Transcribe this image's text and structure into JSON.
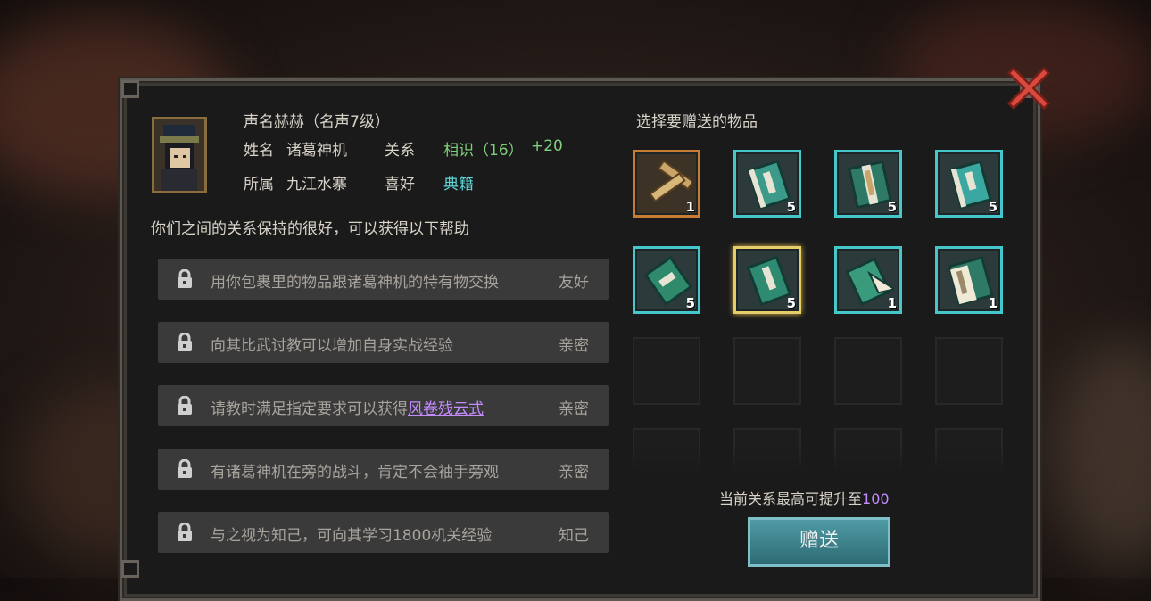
{
  "header": {
    "reputation": "声名赫赫（名声7级）",
    "name_label": "姓名",
    "name_value": "诸葛神机",
    "relation_label": "关系",
    "relation_value": "相识（16）",
    "relation_bonus": "+20",
    "faction_label": "所属",
    "faction_value": "九江水寨",
    "hobby_label": "喜好",
    "hobby_value": "典籍"
  },
  "benefits_intro": "你们之间的关系保持的很好，可以获得以下帮助",
  "benefits": [
    {
      "desc": "用你包裹里的物品跟诸葛神机的特有物交换",
      "level": "友好"
    },
    {
      "desc": "向其比武讨教可以增加自身实战经验",
      "level": "亲密"
    },
    {
      "desc_prefix": "请教时满足指定要求可以获得",
      "desc_link": "风卷残云式",
      "level": "亲密"
    },
    {
      "desc": "有诸葛神机在旁的战斗，肯定不会袖手旁观",
      "level": "亲密"
    },
    {
      "desc": "与之视为知己，可向其学习1800机关经验",
      "level": "知己"
    }
  ],
  "gift_title": "选择要赠送的物品",
  "items": [
    {
      "icon": "scroll-bundle-icon",
      "count": "1"
    },
    {
      "icon": "book-icon",
      "count": "5"
    },
    {
      "icon": "open-book-icon",
      "count": "5"
    },
    {
      "icon": "book-icon",
      "count": "5"
    },
    {
      "icon": "book-icon",
      "count": "5"
    },
    {
      "icon": "book-icon",
      "count": "5"
    },
    {
      "icon": "book-icon",
      "count": "1"
    },
    {
      "icon": "open-book-icon",
      "count": "1"
    }
  ],
  "max_text_prefix": "当前关系最高可提升至",
  "max_value": "100",
  "give_button": "赠送",
  "colors": {
    "accent_cyan": "#46c7cc",
    "relation_green": "#7fd07a",
    "link_purple": "#c58cff",
    "selected_gold": "#e8cc6a"
  }
}
